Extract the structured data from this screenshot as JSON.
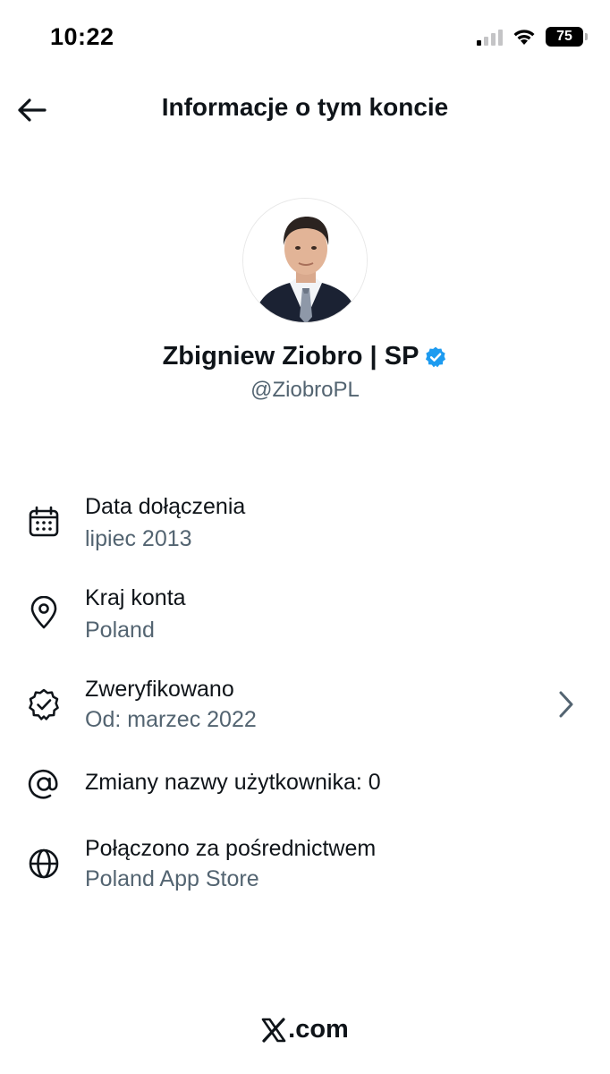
{
  "status_bar": {
    "time": "10:22",
    "battery": "75",
    "signal_icon": "signal-icon",
    "wifi_icon": "wifi-icon"
  },
  "header": {
    "title": "Informacje o tym koncie",
    "back_icon": "arrow-left-icon"
  },
  "profile": {
    "display_name": "Zbigniew Ziobro | SP",
    "handle": "@ZiobroPL",
    "verified_color": "#1d9bf0"
  },
  "details": [
    {
      "icon": "calendar-icon",
      "title": "Data dołączenia",
      "value": "lipiec 2013"
    },
    {
      "icon": "location-pin-icon",
      "title": "Kraj konta",
      "value": "Poland"
    },
    {
      "icon": "verified-badge-icon",
      "title": "Zweryfikowano",
      "value": "Od: marzec 2022"
    },
    {
      "icon": "at-sign-icon",
      "title": "Zmiany nazwy użytkownika: 0",
      "value": ""
    },
    {
      "icon": "globe-icon",
      "title": "Połączono za pośrednictwem",
      "value": "Poland App Store"
    }
  ],
  "footer": {
    "logo_text": ".com",
    "logo_icon": "x-logo-icon"
  },
  "colors": {
    "primary_text": "#0f1419",
    "secondary_text": "#536471",
    "accent": "#1d9bf0"
  }
}
